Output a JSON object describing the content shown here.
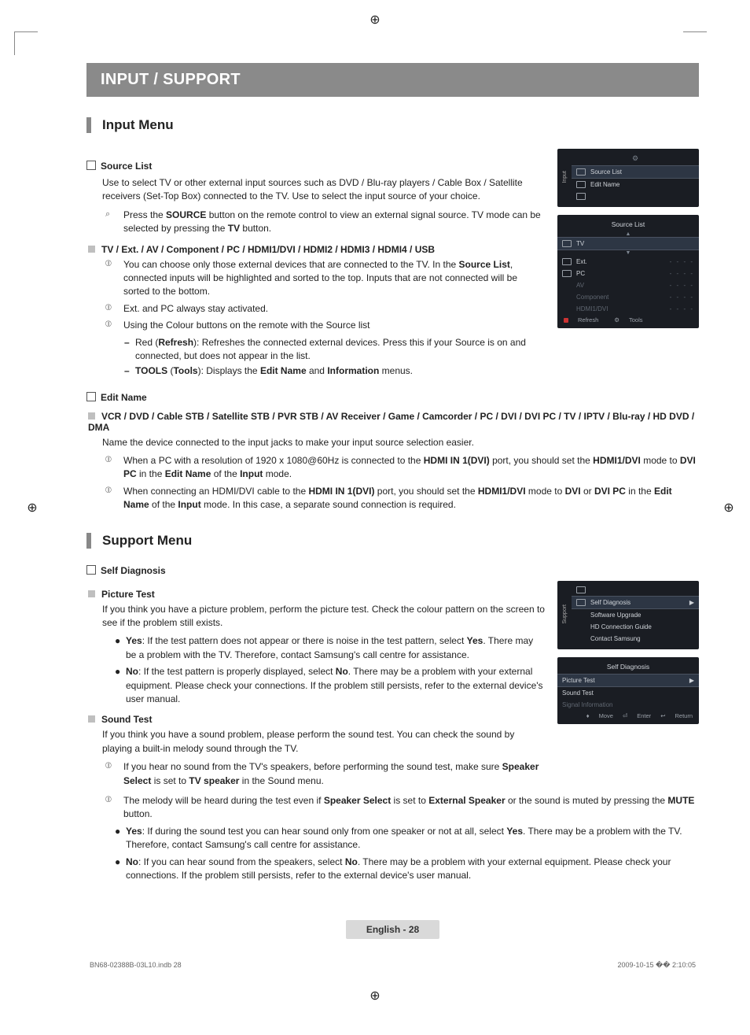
{
  "banner": "INPUT / SUPPORT",
  "sections": {
    "input": {
      "title": "Input Menu",
      "source_list": {
        "head": "Source List",
        "p1": "Use to select TV or other external input sources such as DVD / Blu-ray players / Cable Box / Satellite receivers (Set-Top Box) connected to the TV. Use to select the input source of your choice.",
        "p2_pre": "Press the ",
        "p2_b1": "SOURCE",
        "p2_mid": " button on the remote control to view an external signal source. TV mode can be selected by pressing the ",
        "p2_b2": "TV",
        "p2_post": " button."
      },
      "tv_ext": {
        "head": "TV / Ext. / AV / Component / PC / HDMI1/DVI / HDMI2 / HDMI3 / HDMI4 / USB",
        "n1_a": "You can choose only those external devices that are connected to the TV. In the ",
        "n1_b": "Source List",
        "n1_c": ", connected inputs will be highlighted and sorted to the top. Inputs that are not connected will be sorted to the bottom.",
        "n2": "Ext. and PC always stay activated.",
        "n3": "Using the Colour buttons on the remote with the Source list",
        "d1_a": "Red (",
        "d1_b": "Refresh",
        "d1_c": "): Refreshes the connected external devices. Press this if your Source is on and connected, but does not appear in the list.",
        "d2_a": "TOOLS",
        "d2_b": " (",
        "d2_c": "Tools",
        "d2_d": "): Displays the ",
        "d2_e": "Edit Name",
        "d2_f": " and ",
        "d2_g": "Information",
        "d2_h": " menus."
      },
      "edit_name": {
        "head": "Edit Name",
        "list": "VCR / DVD / Cable STB / Satellite STB / PVR STB / AV Receiver / Game / Camcorder / PC / DVI / DVI PC / TV / IPTV / Blu-ray / HD DVD / DMA",
        "p1": "Name the device connected to the input jacks to make your input source selection easier.",
        "n1_a": "When a PC with a resolution of 1920 x 1080@60Hz is connected to the ",
        "n1_b": "HDMI IN 1(DVI)",
        "n1_c": " port, you should set the ",
        "n1_d": "HDMI1/DVI",
        "n1_e": " mode to ",
        "n1_f": "DVI PC",
        "n1_g": " in the ",
        "n1_h": "Edit Name",
        "n1_i": " of the ",
        "n1_j": "Input",
        "n1_k": " mode.",
        "n2_a": "When connecting an HDMI/DVI cable to the ",
        "n2_b": "HDMI IN 1(DVI)",
        "n2_c": " port, you should set the ",
        "n2_d": "HDMI1/DVI",
        "n2_e": " mode to ",
        "n2_f": "DVI",
        "n2_g": " or ",
        "n2_h": "DVI PC",
        "n2_i": " in the ",
        "n2_j": "Edit Name",
        "n2_k": " of the ",
        "n2_l": "Input",
        "n2_m": " mode. In this case, a separate sound connection is required."
      }
    },
    "support": {
      "title": "Support Menu",
      "self_diag": {
        "head": "Self Diagnosis",
        "picture": {
          "head": "Picture Test",
          "p1": "If you think you have a picture problem, perform the picture test. Check the colour pattern on the screen to see if the problem still exists.",
          "yes_a": "Yes",
          "yes_b": ": If the test pattern does not appear or there is noise in the test pattern, select ",
          "yes_c": "Yes",
          "yes_d": ". There may be a problem with the TV. Therefore, contact Samsung's call centre for assistance.",
          "no_a": "No",
          "no_b": ": If the test pattern is properly displayed, select ",
          "no_c": "No",
          "no_d": ". There may be a problem with your external equipment. Please check your connections. If the problem still persists, refer to the external device's user manual."
        },
        "sound": {
          "head": "Sound Test",
          "p1": "If you think you have a sound problem, please perform the sound test. You can check the sound by playing a built-in melody sound through the TV.",
          "n1_a": "If you hear no sound from the TV's speakers, before performing the sound test, make sure ",
          "n1_b": "Speaker Select",
          "n1_c": " is set to ",
          "n1_d": "TV speaker",
          "n1_e": " in the Sound menu.",
          "n2_a": "The melody will be heard during the test even if ",
          "n2_b": "Speaker Select",
          "n2_c": " is set to ",
          "n2_d": "External Speaker",
          "n2_e": " or the sound is muted by pressing the ",
          "n2_f": "MUTE",
          "n2_g": " button.",
          "yes_a": "Yes",
          "yes_b": ": If during the sound test you can hear sound only from one speaker or not at all, select ",
          "yes_c": "Yes",
          "yes_d": ". There may be a problem with the TV. Therefore, contact Samsung's call centre for assistance.",
          "no_a": "No",
          "no_b": ": If you can hear sound from the speakers, select ",
          "no_c": "No",
          "no_d": ". There may be a problem with your external equipment. Please check your connections. If the problem still persists, refer to the external device's user manual."
        }
      }
    }
  },
  "osd": {
    "input_menu": {
      "side": "Input",
      "items": [
        "Source List",
        "Edit Name"
      ]
    },
    "source_list": {
      "title": "Source List",
      "active": "TV",
      "items": [
        "Ext.",
        "PC",
        "AV",
        "Component",
        "HDMI1/DVI"
      ],
      "dots": "- - - -",
      "foot_left": "Refresh",
      "foot_right": "Tools"
    },
    "support_menu": {
      "side": "Support",
      "hi": "Self Diagnosis",
      "items": [
        "Software Upgrade",
        "HD Connection Guide",
        "Contact Samsung"
      ]
    },
    "self_diag": {
      "title": "Self Diagnosis",
      "hi": "Picture Test",
      "items": [
        "Sound Test",
        "Signal Information"
      ],
      "foot": [
        "Move",
        "Enter",
        "Return"
      ]
    }
  },
  "footer": {
    "label": "English - 28",
    "meta_left": "BN68-02388B-03L10.indb   28",
    "meta_right": "2009-10-15   �� 2:10:05"
  }
}
